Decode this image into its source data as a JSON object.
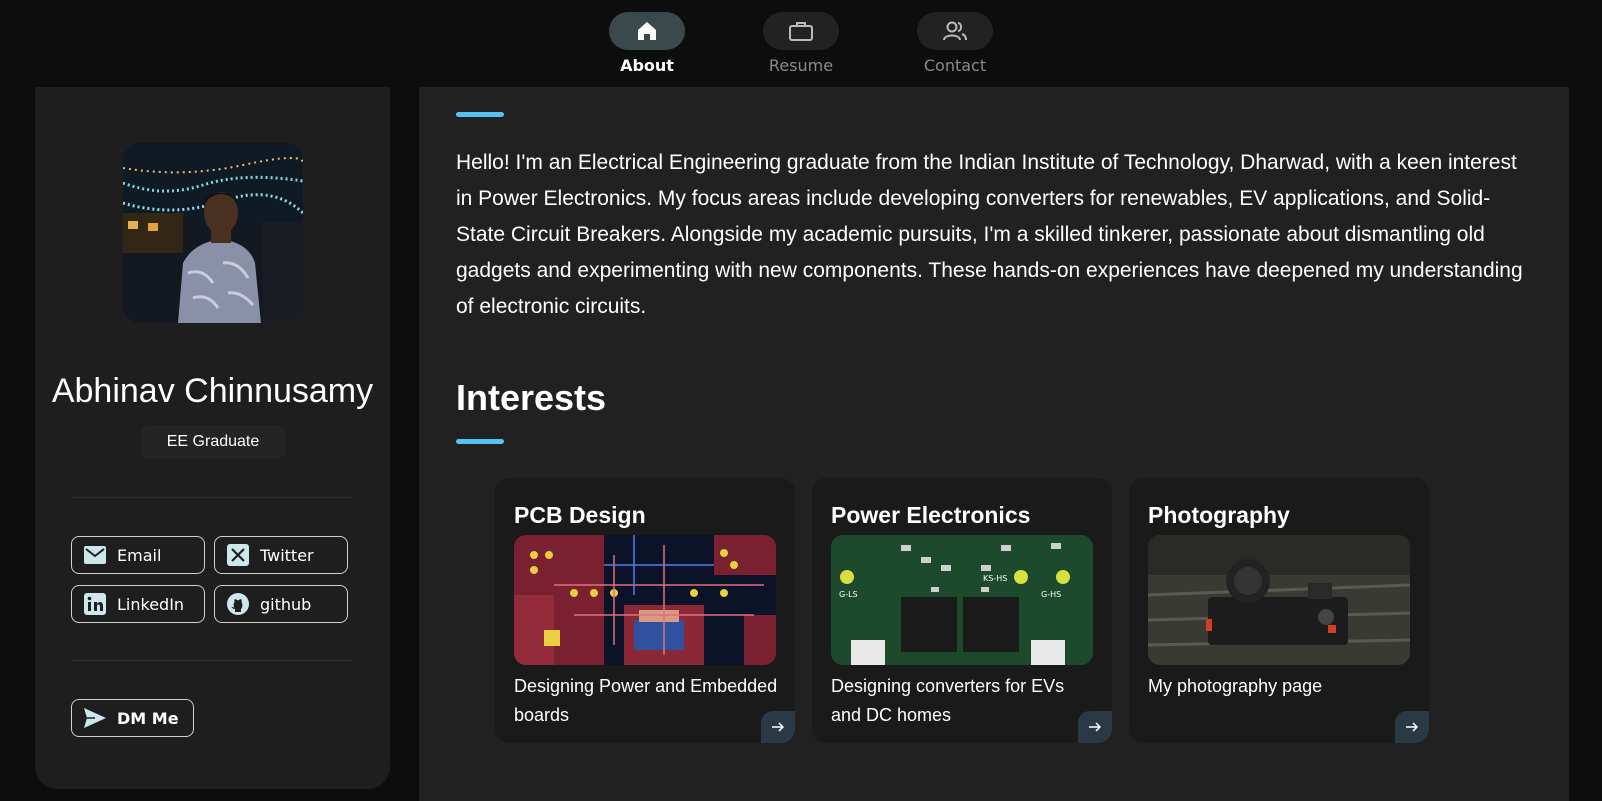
{
  "nav": {
    "items": [
      {
        "label": "About",
        "icon": "home-icon",
        "active": true
      },
      {
        "label": "Resume",
        "icon": "briefcase-icon",
        "active": false
      },
      {
        "label": "Contact",
        "icon": "users-icon",
        "active": false
      }
    ]
  },
  "profile": {
    "name": "Abhinav Chinnusamy",
    "title": "EE Graduate"
  },
  "social": {
    "email": "Email",
    "twitter": "Twitter",
    "linkedin": "LinkedIn",
    "github": "github",
    "dm": "DM Me"
  },
  "about": {
    "text": "Hello! I'm an Electrical Engineering graduate from the Indian Institute of Technology, Dharwad, with a keen interest in Power Electronics. My focus areas include developing converters for renewables, EV applications, and Solid-State Circuit Breakers. Alongside my academic pursuits, I'm a skilled tinkerer, passionate about dismantling old gadgets and experimenting with new components. These hands-on experiences have deepened my understanding of electronic circuits."
  },
  "interests": {
    "title": "Interests",
    "cards": [
      {
        "title": "PCB Design",
        "desc": "Designing Power and Embedded boards"
      },
      {
        "title": "Power Electronics",
        "desc": "Designing converters for EVs and DC homes"
      },
      {
        "title": "Photography",
        "desc": "My photography page"
      }
    ]
  },
  "colors": {
    "accent": "#55c2f0",
    "panel": "#212121",
    "sidebar": "#1e1e1e",
    "background": "#0d0d0d"
  }
}
